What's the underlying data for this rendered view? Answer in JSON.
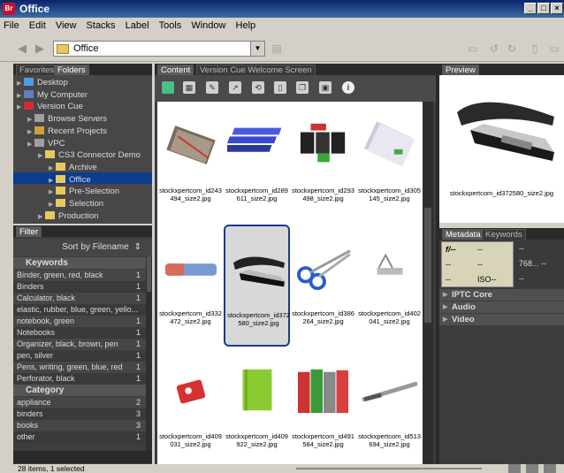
{
  "window": {
    "title": "Office",
    "app_badge": "Br"
  },
  "menu": [
    "File",
    "Edit",
    "View",
    "Stacks",
    "Label",
    "Tools",
    "Window",
    "Help"
  ],
  "path": {
    "current": "Office"
  },
  "left_tabs": [
    "Favorites",
    "Folders"
  ],
  "tree": [
    {
      "label": "Desktop",
      "indent": 0,
      "icon": "desktop-icon"
    },
    {
      "label": "My Computer",
      "indent": 0,
      "icon": "computer-icon"
    },
    {
      "label": "Version Cue",
      "indent": 0,
      "icon": "version-cue-icon"
    },
    {
      "label": "Browse Servers",
      "indent": 1,
      "icon": "server-icon"
    },
    {
      "label": "Recent Projects",
      "indent": 1,
      "icon": "recent-icon"
    },
    {
      "label": "VPC",
      "indent": 1,
      "icon": "server-icon"
    },
    {
      "label": "CS3 Connector Demo",
      "indent": 2,
      "icon": "folder-icon"
    },
    {
      "label": "Archive",
      "indent": 3,
      "icon": "folder-icon"
    },
    {
      "label": "Office",
      "indent": 3,
      "icon": "folder-icon"
    },
    {
      "label": "Pre-Selection",
      "indent": 3,
      "icon": "folder-icon"
    },
    {
      "label": "Selection",
      "indent": 3,
      "icon": "folder-icon"
    },
    {
      "label": "Production",
      "indent": 2,
      "icon": "folder-icon"
    }
  ],
  "filter": {
    "tab": "Filter",
    "sort_label": "Sort by Filename",
    "keywords_title": "Keywords",
    "keywords": [
      {
        "label": "Binder, green, red, black",
        "count": "1"
      },
      {
        "label": "Binders",
        "count": "1"
      },
      {
        "label": "Calculator, black",
        "count": "1"
      },
      {
        "label": "elastic, rubber, blue, green, yello...",
        "count": ""
      },
      {
        "label": "notebook, green",
        "count": "1"
      },
      {
        "label": "Notebooks",
        "count": "1"
      },
      {
        "label": "Organizer, black, brown, pen",
        "count": "1"
      },
      {
        "label": "pen, silver",
        "count": "1"
      },
      {
        "label": "Pens, writing, green, blue, red",
        "count": "1"
      },
      {
        "label": "Perforator, black",
        "count": "1"
      }
    ],
    "category_title": "Category",
    "categories": [
      {
        "label": "appliance",
        "count": "2"
      },
      {
        "label": "binders",
        "count": "3"
      },
      {
        "label": "books",
        "count": "3"
      },
      {
        "label": "other",
        "count": "1"
      }
    ]
  },
  "content_tabs": [
    "Content",
    "Version Cue Welcome Screen"
  ],
  "items": [
    {
      "name": "stockxpertcom_id243494_size2.jpg",
      "kind": "notebook"
    },
    {
      "name": "stockxpertcom_id289611_size2.jpg",
      "kind": "books"
    },
    {
      "name": "stockxpertcom_id293498_size2.jpg",
      "kind": "cartridges"
    },
    {
      "name": "stockxpertcom_id305145_size2.jpg",
      "kind": "papers"
    },
    {
      "name": "stockxpertcom_id332472_size2.jpg",
      "kind": "eraser"
    },
    {
      "name": "stockxpertcom_id372580_size2.jpg",
      "kind": "stapler",
      "selected": true
    },
    {
      "name": "stockxpertcom_id386264_size2.jpg",
      "kind": "scissors"
    },
    {
      "name": "stockxpertcom_id402041_size2.jpg",
      "kind": "clip"
    },
    {
      "name": "stockxpertcom_id409031_size2.jpg",
      "kind": "sharpener"
    },
    {
      "name": "stockxpertcom_id409922_size2.jpg",
      "kind": "greenbook"
    },
    {
      "name": "stockxpertcom_id491584_size2.jpg",
      "kind": "binders"
    },
    {
      "name": "stockxpertcom_id513694_size2.jpg",
      "kind": "pen"
    }
  ],
  "preview": {
    "tab": "Preview",
    "caption": "stockxpertcom_id372580_size2.jpg"
  },
  "metadata": {
    "tabs": [
      "Metadata",
      "Keywords"
    ],
    "fstop": "f/--",
    "v1": "--",
    "v2": "--",
    "v3": "--",
    "iso": "ISO--",
    "r1": "--",
    "r2": "768... --",
    "r3": "--",
    "r4": "--",
    "sections": [
      "IPTC Core",
      "Audio",
      "Video"
    ]
  },
  "status": {
    "text": "28 items, 1 selected"
  }
}
